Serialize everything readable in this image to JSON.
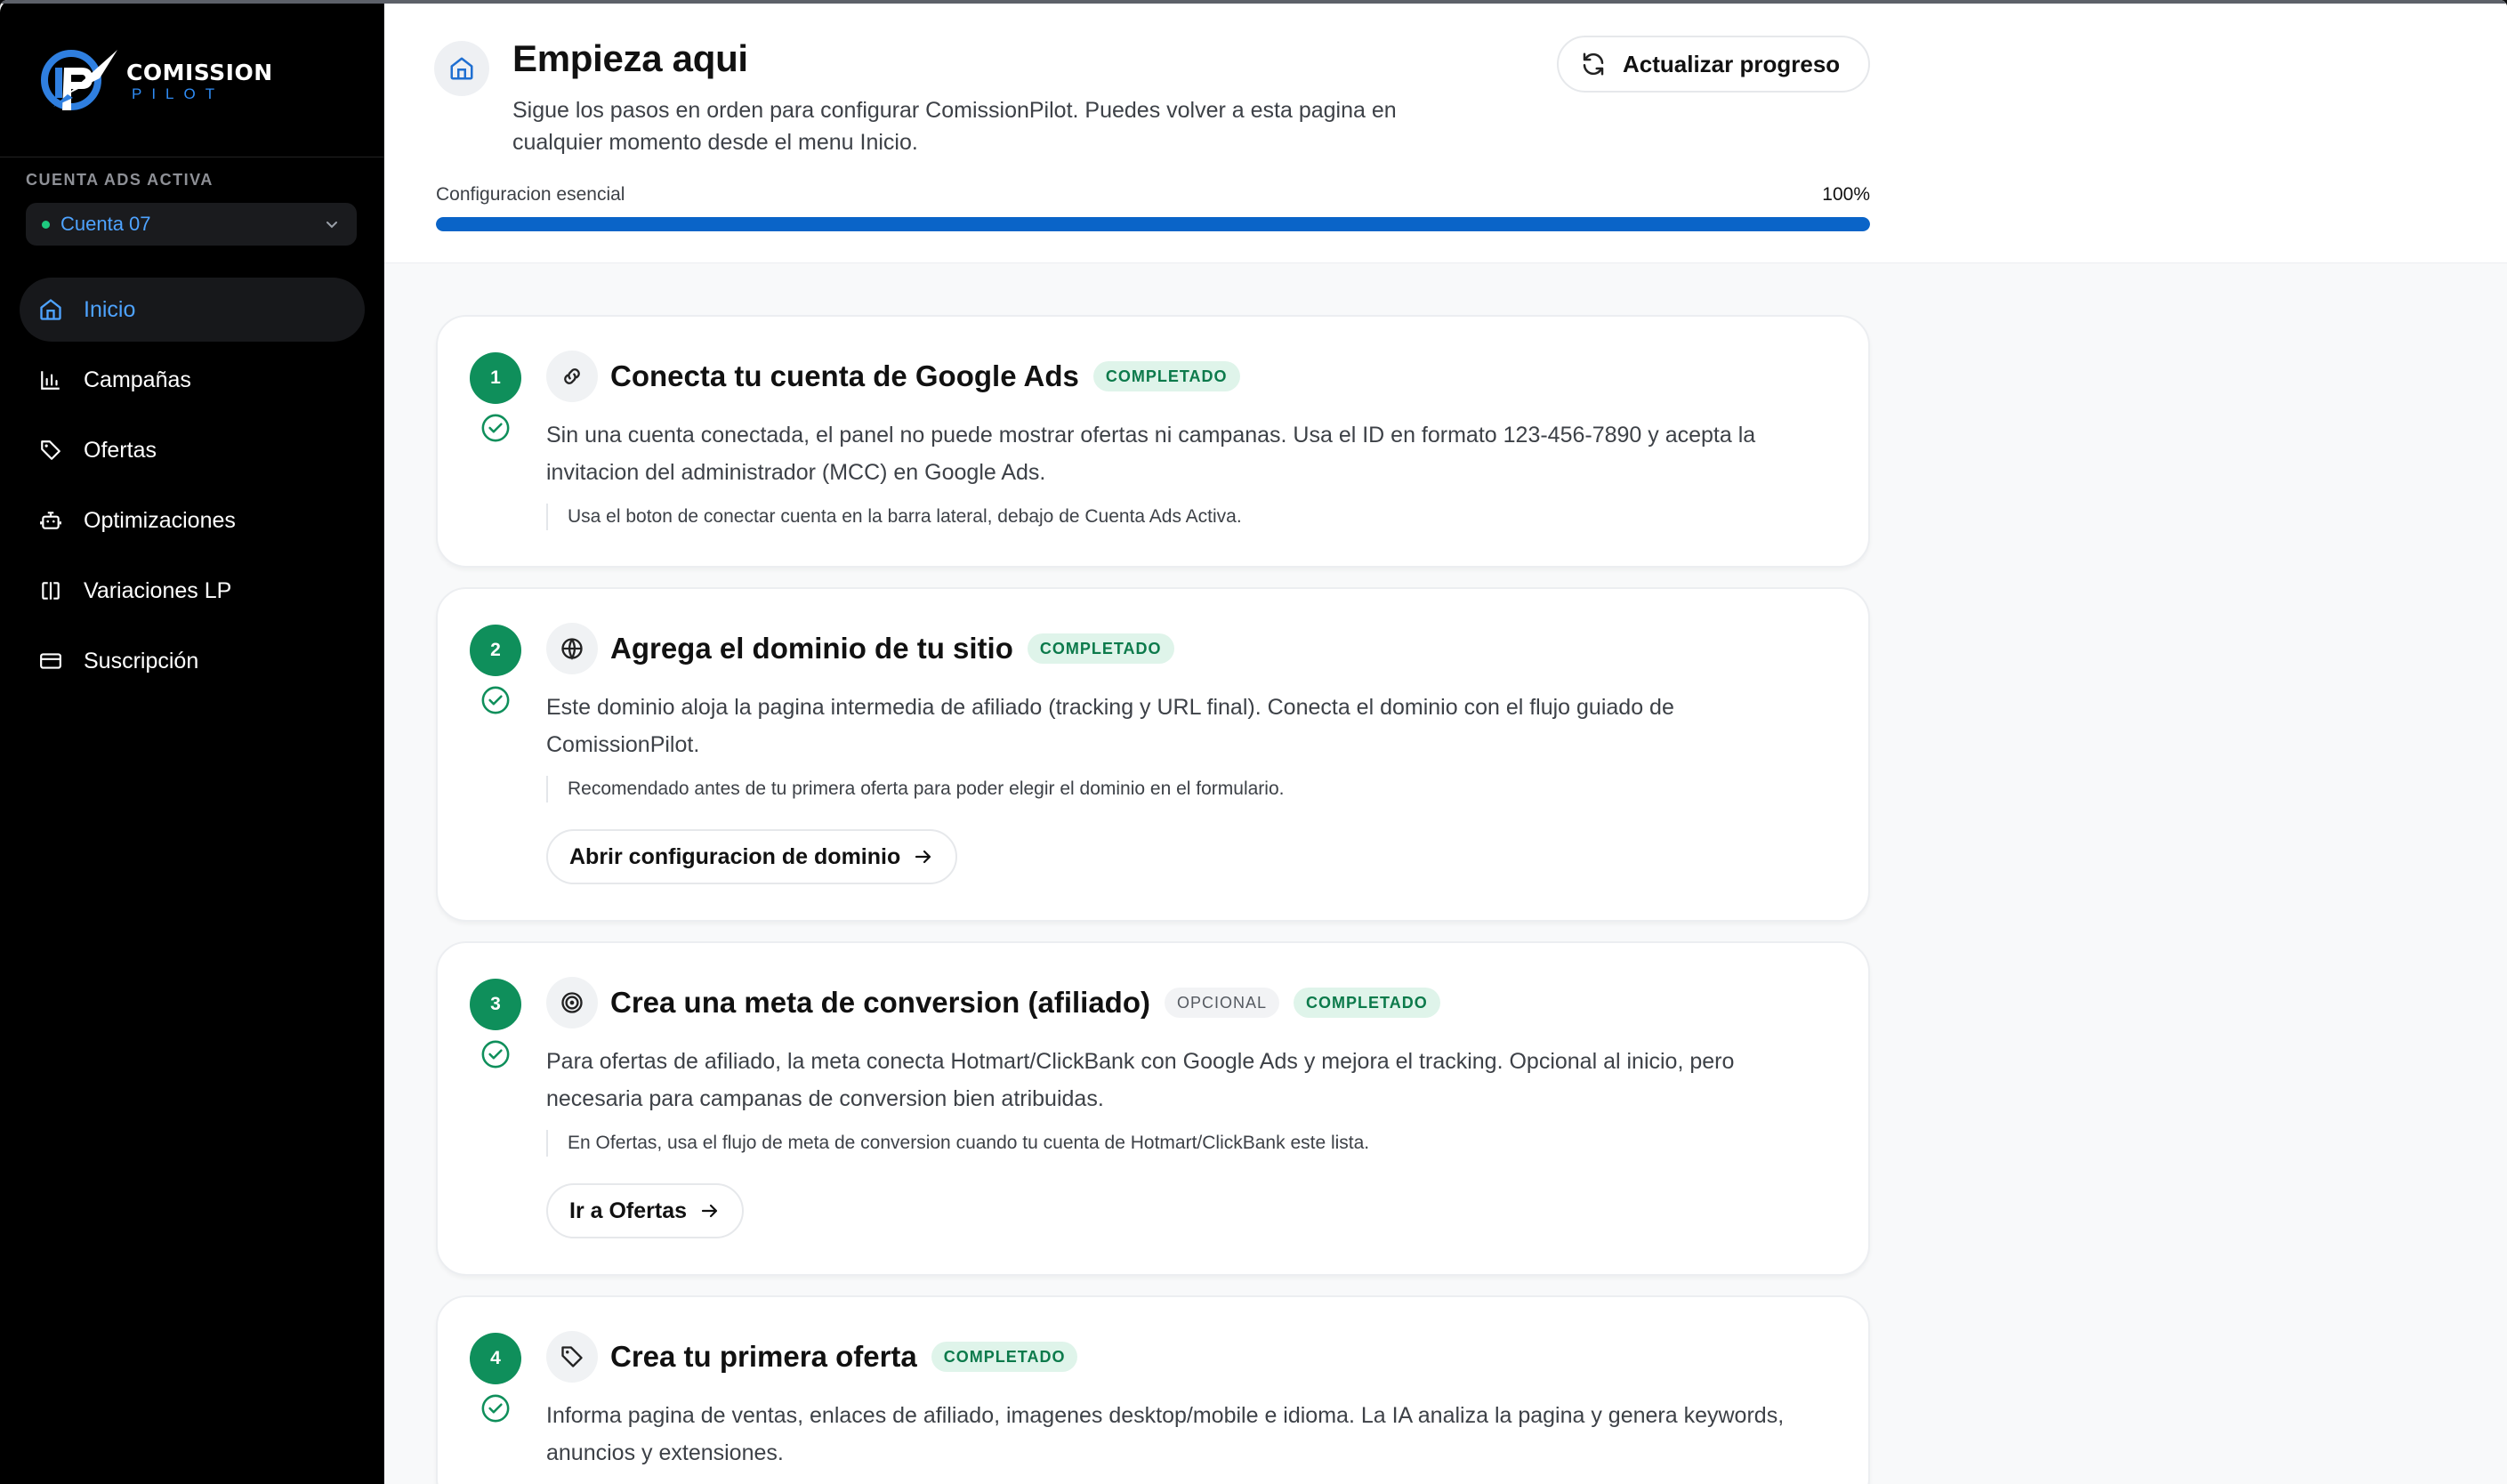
{
  "brand": {
    "line1": "COMISSION",
    "line2": "PILOT"
  },
  "sidebar": {
    "account_label": "CUENTA ADS ACTIVA",
    "account_name": "Cuenta 07",
    "items": [
      {
        "label": "Inicio",
        "icon": "home-icon",
        "active": true
      },
      {
        "label": "Campañas",
        "icon": "bar-chart-icon"
      },
      {
        "label": "Ofertas",
        "icon": "tag-icon"
      },
      {
        "label": "Optimizaciones",
        "icon": "bot-icon"
      },
      {
        "label": "Variaciones LP",
        "icon": "split-icon"
      },
      {
        "label": "Suscripción",
        "icon": "credit-card-icon"
      }
    ]
  },
  "header": {
    "title": "Empieza aqui",
    "subtitle": "Sigue los pasos en orden para configurar ComissionPilot. Puedes volver a esta pagina en cualquier momento desde el menu Inicio.",
    "refresh_label": "Actualizar progreso",
    "progress_label": "Configuracion esencial",
    "progress_pct_text": "100%",
    "progress_value": 100
  },
  "steps": [
    {
      "num": "1",
      "icon": "link-icon",
      "title": "Conecta tu cuenta de Google Ads",
      "badge": "COMPLETADO",
      "desc": "Sin una cuenta conectada, el panel no puede mostrar ofertas ni campanas. Usa el ID en formato 123-456-7890 y acepta la invitacion del administrador (MCC) en Google Ads.",
      "hint": "Usa el boton de conectar cuenta en la barra lateral, debajo de Cuenta Ads Activa."
    },
    {
      "num": "2",
      "icon": "globe-icon",
      "title": "Agrega el dominio de tu sitio",
      "badge": "COMPLETADO",
      "desc": "Este dominio aloja la pagina intermedia de afiliado (tracking y URL final). Conecta el dominio con el flujo guiado de ComissionPilot.",
      "hint": "Recomendado antes de tu primera oferta para poder elegir el dominio en el formulario.",
      "button": "Abrir configuracion de dominio"
    },
    {
      "num": "3",
      "icon": "target-icon",
      "title": "Crea una meta de conversion (afiliado)",
      "optional": "OPCIONAL",
      "badge": "COMPLETADO",
      "desc": "Para ofertas de afiliado, la meta conecta Hotmart/ClickBank con Google Ads y mejora el tracking. Opcional al inicio, pero necesaria para campanas de conversion bien atribuidas.",
      "hint": "En Ofertas, usa el flujo de meta de conversion cuando tu cuenta de Hotmart/ClickBank este lista.",
      "button": "Ir a Ofertas"
    },
    {
      "num": "4",
      "icon": "tag-icon",
      "title": "Crea tu primera oferta",
      "badge": "COMPLETADO",
      "desc": "Informa pagina de ventas, enlaces de afiliado, imagenes desktop/mobile e idioma. La IA analiza la pagina y genera keywords, anuncios y extensiones."
    }
  ]
}
